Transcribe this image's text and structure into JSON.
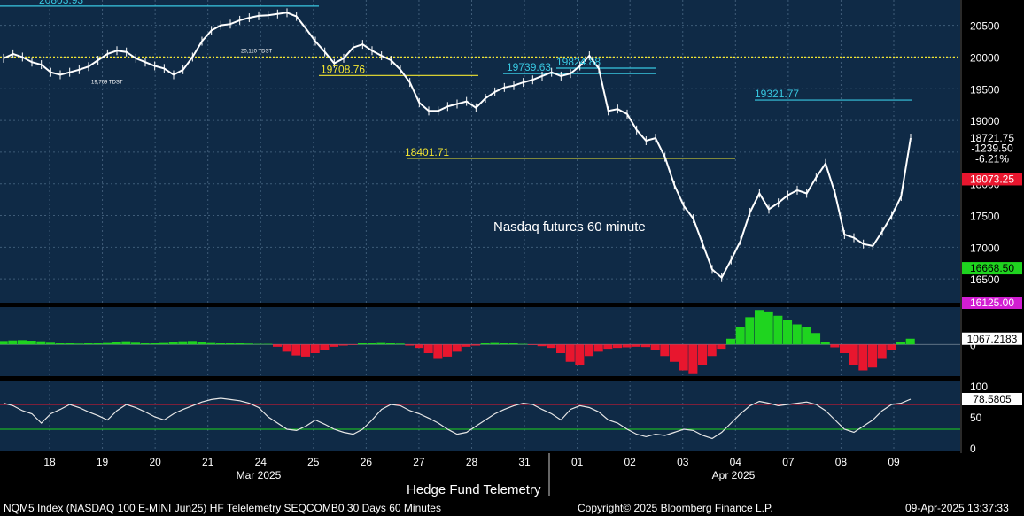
{
  "chart_data": {
    "type": "line",
    "annotation": "Nasdaq futures 60 minute",
    "x_ticks": [
      "18",
      "19",
      "20",
      "21",
      "24",
      "25",
      "26",
      "27",
      "28",
      "31",
      "01",
      "02",
      "03",
      "04",
      "07",
      "08",
      "09"
    ],
    "month_labels": [
      "Mar 2025",
      "Apr 2025"
    ],
    "price_panel": {
      "ylim": [
        16125,
        20900
      ],
      "y_ticks": [
        16500,
        17000,
        17500,
        18000,
        18500,
        19000,
        19500,
        20000,
        20500
      ],
      "series": [
        {
          "values": [
            19980,
            20050,
            20000,
            19920,
            19880,
            19760,
            19720,
            19760,
            19800,
            19850,
            19950,
            20050,
            20100,
            20080,
            19980,
            19920,
            19860,
            19820,
            19720,
            19800,
            20000,
            20250,
            20420,
            20500,
            20520,
            20580,
            20620,
            20650,
            20660,
            20680,
            20700,
            20640,
            20450,
            20250,
            20080,
            19900,
            19980,
            20150,
            20200,
            20100,
            20020,
            19950,
            19800,
            19600,
            19280,
            19150,
            19150,
            19220,
            19260,
            19300,
            19200,
            19350,
            19450,
            19520,
            19550,
            19600,
            19640,
            19700,
            19760,
            19700,
            19740,
            19860,
            20020,
            19820,
            19150,
            19180,
            19100,
            18850,
            18680,
            18720,
            18420,
            17980,
            17650,
            17450,
            17050,
            16650,
            16520,
            16800,
            17100,
            17550,
            17850,
            17600,
            17700,
            17820,
            17900,
            17850,
            18100,
            18320,
            17850,
            17200,
            17150,
            17050,
            17020,
            17250,
            17500,
            17800,
            18721.75
          ]
        }
      ],
      "value_labels": [
        "20803.93",
        "19708.76",
        "19739.63",
        "19824.88",
        "19321.77",
        "18401.71"
      ],
      "right_axis_labels": [
        {
          "text": "18721.75",
          "value": 18721.75,
          "color": "#ffffff"
        },
        {
          "text": "-1239.50",
          "value": 18560,
          "color": "#ffffff"
        },
        {
          "text": "-6.21%",
          "value": 18395,
          "color": "#ffffff"
        },
        {
          "text": "18073.25",
          "value": 18073.25,
          "color": "#e8162e"
        },
        {
          "text": "16668.50",
          "value": 16668.5,
          "color": "#1fd41f"
        },
        {
          "text": "16125.00",
          "value": 16125,
          "color": "#d21ed2"
        }
      ],
      "small_labels": [
        "20,110 TDST",
        "19,769 TDST"
      ]
    },
    "histogram_panel": {
      "last_value": "1067.2183",
      "y_ticks": [
        "0"
      ],
      "values": [
        120,
        140,
        150,
        130,
        110,
        90,
        60,
        40,
        30,
        40,
        60,
        80,
        100,
        110,
        90,
        70,
        60,
        80,
        100,
        110,
        120,
        100,
        80,
        60,
        50,
        40,
        30,
        20,
        20,
        -80,
        -250,
        -380,
        -420,
        -300,
        -180,
        -80,
        -40,
        -20,
        40,
        60,
        80,
        60,
        30,
        -40,
        -120,
        -300,
        -500,
        -420,
        -250,
        -80,
        -40,
        60,
        80,
        60,
        40,
        20,
        -20,
        -60,
        -120,
        -300,
        -600,
        -700,
        -400,
        -250,
        -150,
        -120,
        -100,
        -80,
        -90,
        -200,
        -400,
        -600,
        -900,
        -1000,
        -700,
        -400,
        -150,
        200,
        600,
        950,
        1200,
        1150,
        1000,
        850,
        700,
        600,
        400,
        100,
        -100,
        -300,
        -700,
        -900,
        -800,
        -500,
        -200,
        100,
        200
      ]
    },
    "oscillator_panel": {
      "last_value": "78.5805",
      "y_ticks": [
        "100",
        "50",
        "0"
      ],
      "levels": [
        70,
        30
      ],
      "values": [
        72,
        68,
        60,
        55,
        40,
        55,
        62,
        70,
        65,
        58,
        52,
        45,
        60,
        70,
        65,
        58,
        50,
        45,
        55,
        62,
        68,
        74,
        78,
        80,
        78,
        76,
        72,
        65,
        50,
        40,
        30,
        28,
        35,
        45,
        38,
        30,
        25,
        22,
        30,
        45,
        62,
        70,
        68,
        60,
        55,
        48,
        40,
        30,
        22,
        25,
        35,
        45,
        55,
        62,
        68,
        72,
        70,
        62,
        55,
        45,
        62,
        68,
        65,
        58,
        45,
        40,
        30,
        22,
        18,
        22,
        20,
        25,
        30,
        28,
        20,
        15,
        25,
        40,
        55,
        68,
        75,
        72,
        68,
        70,
        72,
        74,
        70,
        60,
        45,
        30,
        25,
        35,
        45,
        60,
        70,
        72,
        78.58
      ]
    }
  },
  "footer": {
    "panel_title": "Hedge Fund Telemetry",
    "security": "NQM5 Index (NASDAQ 100 E-MINI Jun25) HF Telelemetry SEQCOMB0 30 Days 60 Minutes",
    "copyright": "Copyright© 2025 Bloomberg Finance L.P.",
    "timestamp": "09-Apr-2025 13:37:33"
  },
  "colors": {
    "panel_bg": "#0f2a46",
    "price_line": "#ffffff",
    "hist_pos": "#1fd41f",
    "hist_neg": "#e8162e",
    "osc_line": "#e6e6e6",
    "upper_level": "#e8162e",
    "lower_level": "#1fd41f",
    "label_yellow": "#f2e531",
    "label_cyan": "#38c7e0"
  }
}
